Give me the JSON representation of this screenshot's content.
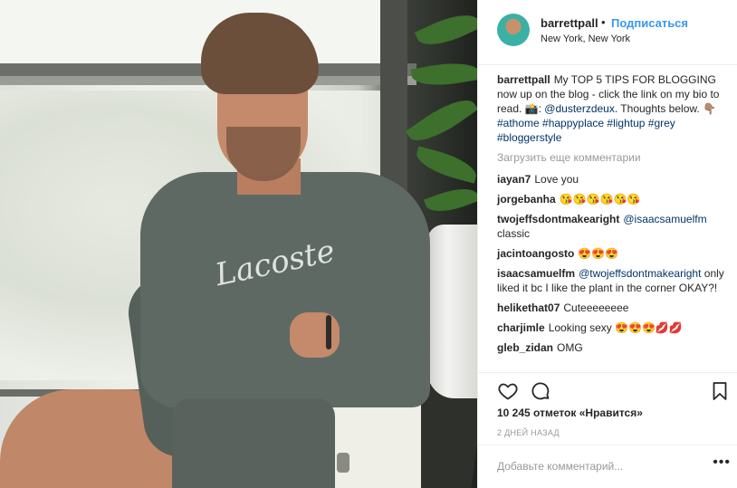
{
  "header": {
    "username": "barrettpall",
    "separator": "•",
    "follow_label": "Подписаться",
    "location": "New York, New York"
  },
  "caption": {
    "username": "barrettpall",
    "text_before": "My TOP 5 TIPS FOR BLOGGING now up on the blog - click the link on my bio to read. 📸: ",
    "mention": "@dusterzdeux",
    "text_after": ". Thoughts below. 👇🏽 ",
    "hashtags": "#athome #happyplace #lightup #grey #bloggerstyle"
  },
  "load_more": "Загрузить еще комментарии",
  "comments": [
    {
      "user": "iayan7",
      "mention": "",
      "text": "Love you"
    },
    {
      "user": "jorgebanha",
      "mention": "",
      "text": "😘😘😘😘😘😘"
    },
    {
      "user": "twojeffsdontmakearight",
      "mention": "@isaacsamuelfm",
      "text": "classic"
    },
    {
      "user": "jacintoangosto",
      "mention": "",
      "text": "😍😍😍"
    },
    {
      "user": "isaacsamuelfm",
      "mention": "@twojeffsdontmakearight",
      "text": "only liked it bc I like the plant in the corner OKAY?!"
    },
    {
      "user": "helikethat07",
      "mention": "",
      "text": "Cuteeeeeeee"
    },
    {
      "user": "charjimle",
      "mention": "",
      "text": "Looking sexy 😍😍😍💋💋"
    },
    {
      "user": "gleb_zidan",
      "mention": "",
      "text": "OMG"
    }
  ],
  "actions": {
    "like_icon": "heart-icon",
    "comment_icon": "comment-icon",
    "save_icon": "bookmark-icon",
    "likes": "10 245 отметок «Нравится»",
    "date": "2 ДНЕЙ НАЗАД"
  },
  "add_comment": {
    "placeholder": "Добавьте комментарий...",
    "more": "•••"
  },
  "colors": {
    "link": "#003569",
    "follow": "#3897f0",
    "muted": "#999999"
  }
}
